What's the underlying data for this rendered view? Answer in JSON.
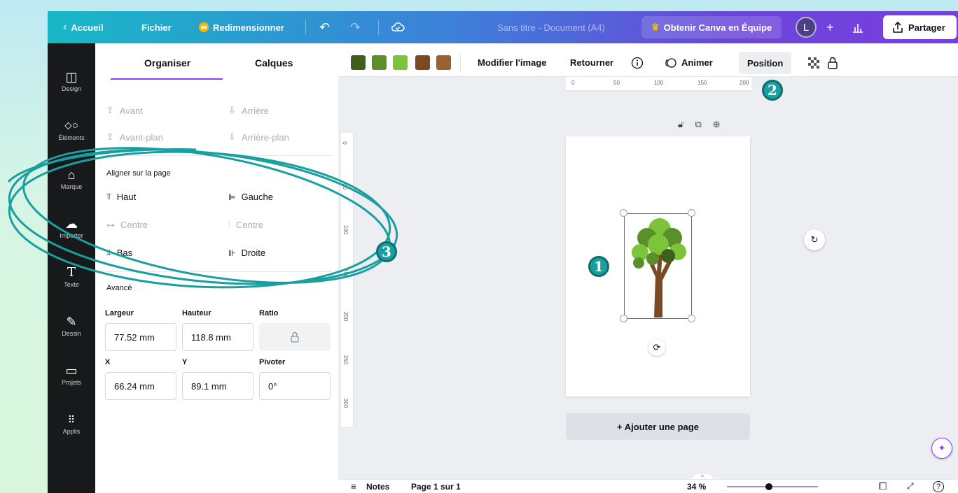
{
  "topbar": {
    "back_label": "Accueil",
    "file_label": "Fichier",
    "resize_label": "Redimensionner",
    "doc_title": "Sans titre - Document (A4)",
    "team_label": "Obtenir Canva en Équipe",
    "avatar_letter": "L",
    "plus_label": "+",
    "share_label": "Partager"
  },
  "rail": [
    {
      "label": "Design",
      "icon": "layout-icon"
    },
    {
      "label": "Éléments",
      "icon": "shapes-icon"
    },
    {
      "label": "Marque",
      "icon": "brand-icon"
    },
    {
      "label": "Importer",
      "icon": "upload-icon"
    },
    {
      "label": "Texte",
      "icon": "text-icon"
    },
    {
      "label": "Dessin",
      "icon": "draw-icon"
    },
    {
      "label": "Projets",
      "icon": "folder-icon"
    },
    {
      "label": "Applis",
      "icon": "apps-icon"
    }
  ],
  "panel": {
    "tab_arrange": "Organiser",
    "tab_layers": "Calques",
    "forward": "Avant",
    "backward": "Arrière",
    "to_front": "Avant-plan",
    "to_back": "Arrière-plan",
    "align_title": "Aligner sur la page",
    "top": "Haut",
    "left": "Gauche",
    "center_v": "Centre",
    "center_h": "Centre",
    "bottom": "Bas",
    "right": "Droite",
    "advanced": "Avancé",
    "width_label": "Largeur",
    "height_label": "Hauteur",
    "ratio_label": "Ratio",
    "width_value": "77.52 mm",
    "height_value": "118.8 mm",
    "x_label": "X",
    "y_label": "Y",
    "rotate_label": "Pivoter",
    "x_value": "66.24 mm",
    "y_value": "89.1 mm",
    "rotate_value": "0°"
  },
  "toolbar": {
    "swatches": [
      "#3f5f1f",
      "#5a8f2a",
      "#7ec43a",
      "#7a4a25",
      "#9a6230"
    ],
    "edit_image": "Modifier l'image",
    "flip": "Retourner",
    "animate": "Animer",
    "position": "Position"
  },
  "ruler": {
    "h": [
      "0",
      "50",
      "100",
      "150",
      "200"
    ],
    "v": [
      "0",
      "50",
      "100",
      "150",
      "200",
      "250",
      "300"
    ]
  },
  "canvas": {
    "add_page": "+ Ajouter une page"
  },
  "footer": {
    "notes": "Notes",
    "page_info": "Page 1 sur 1",
    "zoom": "34 %",
    "zoom_level": 0.34,
    "help": "?"
  },
  "badges": {
    "one": "1",
    "two": "2",
    "three": "3"
  },
  "accent_colors": {
    "purple": "#8b3dff",
    "teal_annotation": "#1a9fa0"
  }
}
